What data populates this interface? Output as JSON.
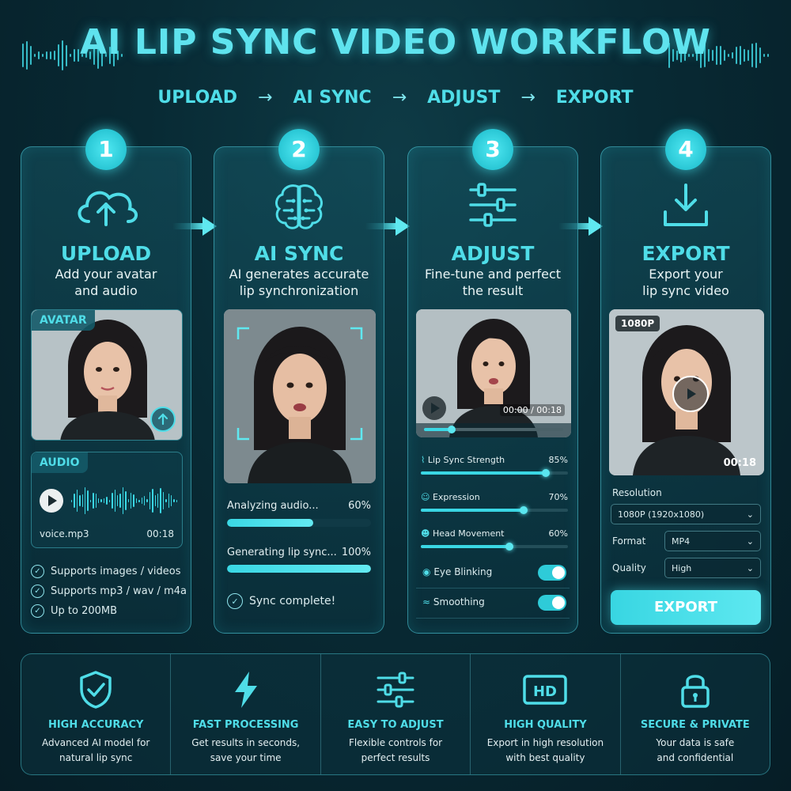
{
  "header": {
    "title": "AI LIP SYNC VIDEO WORKFLOW",
    "steps": [
      "UPLOAD",
      "AI SYNC",
      "ADJUST",
      "EXPORT"
    ],
    "arrow": "→"
  },
  "cards": [
    {
      "num": "1",
      "title": "UPLOAD",
      "desc_line1": "Add your avatar",
      "desc_line2": "and audio",
      "icon": "cloud-upload-icon"
    },
    {
      "num": "2",
      "title": "AI SYNC",
      "desc_line1": "AI generates accurate",
      "desc_line2": "lip synchronization",
      "icon": "brain-icon"
    },
    {
      "num": "3",
      "title": "ADJUST",
      "desc_line1": "Fine-tune and perfect",
      "desc_line2": "the result",
      "icon": "sliders-icon"
    },
    {
      "num": "4",
      "title": "EXPORT",
      "desc_line1": "Export your",
      "desc_line2": "lip sync video",
      "icon": "download-icon"
    }
  ],
  "upload": {
    "avatar_label": "AVATAR",
    "audio_label": "AUDIO",
    "file_name": "voice.mp3",
    "duration": "00:18",
    "checks": [
      "Supports images / videos",
      "Supports mp3 / wav / m4a",
      "Up to 200MB"
    ]
  },
  "sync": {
    "tasks": [
      {
        "label": "Analyzing audio...",
        "percent_text": "60%",
        "progress": 0.6
      },
      {
        "label": "Generating lip sync...",
        "percent_text": "100%",
        "progress": 1.0
      }
    ],
    "complete": "Sync complete!"
  },
  "adjust": {
    "timecode": "00:00 / 00:18",
    "playback_progress": 0.2,
    "sliders": [
      {
        "label": "Lip Sync Strength",
        "value_text": "85%",
        "value": 0.85
      },
      {
        "label": "Expression",
        "value_text": "70%",
        "value": 0.7
      },
      {
        "label": "Head Movement",
        "value_text": "60%",
        "value": 0.6
      }
    ],
    "toggles": [
      {
        "label": "Eye Blinking",
        "on": true
      },
      {
        "label": "Smoothing",
        "on": true
      }
    ]
  },
  "export": {
    "resolution_badge": "1080P",
    "duration": "00:18",
    "resolution_label": "Resolution",
    "resolution_value": "1080P (1920x1080)",
    "format_label": "Format",
    "format_value": "MP4",
    "quality_label": "Quality",
    "quality_value": "High",
    "button": "EXPORT"
  },
  "features": [
    {
      "icon": "shield-check-icon",
      "title": "HIGH ACCURACY",
      "line1": "Advanced AI model for",
      "line2": "natural lip sync"
    },
    {
      "icon": "lightning-icon",
      "title": "FAST PROCESSING",
      "line1": "Get results in seconds,",
      "line2": "save your time"
    },
    {
      "icon": "sliders-icon",
      "title": "EASY TO ADJUST",
      "line1": "Flexible controls for",
      "line2": "perfect results"
    },
    {
      "icon": "hd-icon",
      "title": "HIGH QUALITY",
      "line1": "Export in high resolution",
      "line2": "with best quality"
    },
    {
      "icon": "lock-icon",
      "title": "SECURE & PRIVATE",
      "line1": "Your data is safe",
      "line2": "and confidential"
    }
  ],
  "colors": {
    "accent": "#4fdde8",
    "background": "#082a34",
    "bar_fill": "#3ad7e4"
  }
}
